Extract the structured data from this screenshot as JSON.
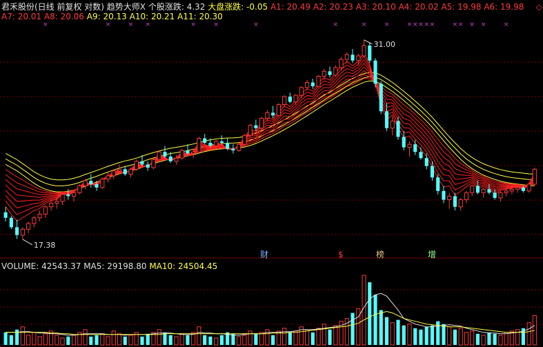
{
  "header": {
    "row1": [
      {
        "text": "君禾股份(日线 前复权 对数) 趋势大师X  个股涨跌: 4.32",
        "color": "#e0e0e0"
      },
      {
        "text": " 大盘涨跌: -0.05",
        "color": "#ffff44"
      },
      {
        "text": "  A1: 20.49  A2: 20.23  A3: 20.10  A4: 20.02  A5: 19.98  A6: 19.98",
        "color": "#ff3b3b"
      }
    ],
    "row2": [
      {
        "text": "A7: 20.01  A8: 20.06",
        "color": "#ff3b3b"
      },
      {
        "text": "  A9: 20.13  A10: 20.21  A11: 20.30",
        "color": "#ffff44"
      }
    ],
    "top_right_marker": "◇"
  },
  "volume_header": [
    {
      "text": "VOLUME: 42543.37",
      "color": "#e0e0e0"
    },
    {
      "text": "  MA5: 29198.80",
      "color": "#e0e0e0"
    },
    {
      "text": "  MA10: 24504.45",
      "color": "#ffff44"
    }
  ],
  "colors": {
    "background": "#000000",
    "grid": "#7a0000",
    "up_candle": "#ff3b3b",
    "down_candle": "#54ffff",
    "ribbon_red": "#ff2020",
    "ribbon_yellow": "#ffff44",
    "volume_up": "#ff3b3b",
    "volume_down": "#54ffff",
    "event_marker": "#cc44cc"
  },
  "chart_data": [
    {
      "type": "candlestick",
      "scale": "log",
      "ylim": [
        17.0,
        32.0
      ],
      "high_label": "31.00",
      "low_label": "17.38",
      "ohlc": [
        [
          18.8,
          19.1,
          18.3,
          18.5
        ],
        [
          18.5,
          18.6,
          17.9,
          18.0
        ],
        [
          18.0,
          18.4,
          17.4,
          17.6
        ],
        [
          17.6,
          18.0,
          17.38,
          17.9
        ],
        [
          17.9,
          18.3,
          17.7,
          18.2
        ],
        [
          18.2,
          18.6,
          18.0,
          18.5
        ],
        [
          18.5,
          18.9,
          18.3,
          18.7
        ],
        [
          18.7,
          19.2,
          18.5,
          19.1
        ],
        [
          19.1,
          19.5,
          18.9,
          19.3
        ],
        [
          19.3,
          19.6,
          19.0,
          19.4
        ],
        [
          19.4,
          19.9,
          19.2,
          19.8
        ],
        [
          19.8,
          20.1,
          19.5,
          19.7
        ],
        [
          19.7,
          20.0,
          19.4,
          19.9
        ],
        [
          19.9,
          20.4,
          19.8,
          20.3
        ],
        [
          20.3,
          20.7,
          20.1,
          20.6
        ],
        [
          20.6,
          21.0,
          20.2,
          20.4
        ],
        [
          20.4,
          20.6,
          20.0,
          20.2
        ],
        [
          20.2,
          20.8,
          20.1,
          20.7
        ],
        [
          20.7,
          21.1,
          20.5,
          20.9
        ],
        [
          20.9,
          21.3,
          20.7,
          21.2
        ],
        [
          21.2,
          21.6,
          21.0,
          21.3
        ],
        [
          21.3,
          21.5,
          20.9,
          21.0
        ],
        [
          21.0,
          21.4,
          20.8,
          21.3
        ],
        [
          21.3,
          21.9,
          21.2,
          21.8
        ],
        [
          21.8,
          22.2,
          21.5,
          21.6
        ],
        [
          21.6,
          21.8,
          21.2,
          21.4
        ],
        [
          21.4,
          22.0,
          21.3,
          21.9
        ],
        [
          21.9,
          22.5,
          21.8,
          22.4
        ],
        [
          22.4,
          22.8,
          22.0,
          22.1
        ],
        [
          22.1,
          22.4,
          21.7,
          21.8
        ],
        [
          21.8,
          22.2,
          21.6,
          22.0
        ],
        [
          22.0,
          22.6,
          21.9,
          22.5
        ],
        [
          22.5,
          22.9,
          22.2,
          22.3
        ],
        [
          22.3,
          22.6,
          22.0,
          22.4
        ],
        [
          22.4,
          23.4,
          22.3,
          23.3
        ],
        [
          23.3,
          23.6,
          22.9,
          23.0
        ],
        [
          23.0,
          23.3,
          22.7,
          22.8
        ],
        [
          22.8,
          23.2,
          22.6,
          23.1
        ],
        [
          23.1,
          23.5,
          22.9,
          23.0
        ],
        [
          23.0,
          23.3,
          22.5,
          22.6
        ],
        [
          22.6,
          22.9,
          22.3,
          22.5
        ],
        [
          22.5,
          23.0,
          22.4,
          22.9
        ],
        [
          22.9,
          23.6,
          22.8,
          23.5
        ],
        [
          23.5,
          24.3,
          23.4,
          24.2
        ],
        [
          24.2,
          24.6,
          23.8,
          24.0
        ],
        [
          24.0,
          24.8,
          23.9,
          24.7
        ],
        [
          24.7,
          25.3,
          24.5,
          25.1
        ],
        [
          25.1,
          25.6,
          24.7,
          24.9
        ],
        [
          24.9,
          25.8,
          24.8,
          25.7
        ],
        [
          25.7,
          26.4,
          25.5,
          26.3
        ],
        [
          26.3,
          26.6,
          25.8,
          25.9
        ],
        [
          25.9,
          26.5,
          25.7,
          26.4
        ],
        [
          26.4,
          27.1,
          26.2,
          27.0
        ],
        [
          27.0,
          27.6,
          26.8,
          27.4
        ],
        [
          27.4,
          27.7,
          26.9,
          27.1
        ],
        [
          27.1,
          28.0,
          27.0,
          27.9
        ],
        [
          27.9,
          28.5,
          27.6,
          28.3
        ],
        [
          28.3,
          28.7,
          27.8,
          28.0
        ],
        [
          28.0,
          28.8,
          27.9,
          28.6
        ],
        [
          28.6,
          29.5,
          28.4,
          29.3
        ],
        [
          29.3,
          29.9,
          29.0,
          29.7
        ],
        [
          29.7,
          30.2,
          29.0,
          29.2
        ],
        [
          29.2,
          29.8,
          28.8,
          29.6
        ],
        [
          29.6,
          31.0,
          29.5,
          30.5
        ],
        [
          30.5,
          30.8,
          29.0,
          29.2
        ],
        [
          29.2,
          29.4,
          27.0,
          27.3
        ],
        [
          27.3,
          27.5,
          25.0,
          25.2
        ],
        [
          25.2,
          25.8,
          23.8,
          24.0
        ],
        [
          24.0,
          24.8,
          23.5,
          24.5
        ],
        [
          24.5,
          24.8,
          23.2,
          23.4
        ],
        [
          23.4,
          23.8,
          22.5,
          22.7
        ],
        [
          22.7,
          23.1,
          22.1,
          22.9
        ],
        [
          22.9,
          23.2,
          22.2,
          22.4
        ],
        [
          22.4,
          22.7,
          21.9,
          22.0
        ],
        [
          22.0,
          22.3,
          21.3,
          21.5
        ],
        [
          21.5,
          21.8,
          20.6,
          20.8
        ],
        [
          20.8,
          21.0,
          19.8,
          20.0
        ],
        [
          20.0,
          20.3,
          19.3,
          19.5
        ],
        [
          19.5,
          19.9,
          19.0,
          19.7
        ],
        [
          19.7,
          19.9,
          18.9,
          19.1
        ],
        [
          19.1,
          19.6,
          18.9,
          19.5
        ],
        [
          19.5,
          20.0,
          19.3,
          19.9
        ],
        [
          19.9,
          20.4,
          19.7,
          20.3
        ],
        [
          20.3,
          20.6,
          19.8,
          19.9
        ],
        [
          19.9,
          20.2,
          19.6,
          20.1
        ],
        [
          20.1,
          20.4,
          19.8,
          19.9
        ],
        [
          19.9,
          20.1,
          19.5,
          19.6
        ],
        [
          19.6,
          20.0,
          19.4,
          19.9
        ],
        [
          19.9,
          20.2,
          19.7,
          20.0
        ],
        [
          20.0,
          20.3,
          19.8,
          20.1
        ],
        [
          20.1,
          20.4,
          19.9,
          20.2
        ],
        [
          20.2,
          20.3,
          19.9,
          20.0
        ],
        [
          20.0,
          20.5,
          19.9,
          20.4
        ],
        [
          20.4,
          21.4,
          20.3,
          21.3
        ]
      ],
      "ribbon_yellow": [
        [
          21.6,
          21.4,
          21.2,
          20.95,
          20.7,
          20.45,
          20.25,
          20.1,
          20.0,
          19.95,
          19.95,
          19.98,
          20.05,
          20.15,
          20.28,
          20.4,
          20.52,
          20.65,
          20.78,
          20.9,
          21.02,
          21.12,
          21.2,
          21.3,
          21.42,
          21.55,
          21.66,
          21.76,
          21.86,
          21.94,
          22.0,
          22.06,
          22.14,
          22.22,
          22.32,
          22.42,
          22.5,
          22.56,
          22.6,
          22.62,
          22.63,
          22.66,
          22.72,
          22.82,
          22.96,
          23.12,
          23.3,
          23.48,
          23.68,
          23.9,
          24.12,
          24.36,
          24.62,
          24.88,
          25.14,
          25.42,
          25.7,
          25.96,
          26.22,
          26.5,
          26.78,
          27.02,
          27.22,
          27.42,
          27.52,
          27.48,
          27.28,
          27.0,
          26.7,
          26.36,
          26.0,
          25.64,
          25.26,
          24.88,
          24.48,
          24.06,
          23.6,
          23.14,
          22.7,
          22.3,
          21.92,
          21.6,
          21.34,
          21.12,
          20.94,
          20.8,
          20.68,
          20.58,
          20.5,
          20.44,
          20.4,
          20.36,
          20.32,
          20.3
        ]
      ],
      "ribbon_red_spread": [
        0.1,
        0.2,
        0.3,
        0.4,
        0.5,
        0.6,
        0.7,
        0.8
      ],
      "event_labels": [
        "财",
        "$",
        "榜",
        "增"
      ]
    },
    {
      "type": "bar",
      "name": "VOLUME",
      "values": [
        18,
        14,
        22,
        26,
        14,
        18,
        12,
        16,
        20,
        14,
        10,
        12,
        14,
        18,
        22,
        12,
        14,
        16,
        12,
        20,
        16,
        12,
        14,
        18,
        12,
        16,
        18,
        22,
        18,
        14,
        12,
        16,
        14,
        18,
        26,
        14,
        12,
        10,
        14,
        18,
        16,
        12,
        14,
        20,
        16,
        18,
        22,
        14,
        20,
        24,
        18,
        20,
        26,
        22,
        18,
        24,
        30,
        22,
        28,
        34,
        38,
        46,
        52,
        100,
        90,
        72,
        50,
        40,
        32,
        36,
        28,
        30,
        24,
        22,
        26,
        28,
        34,
        30,
        26,
        22,
        24,
        18,
        20,
        16,
        14,
        18,
        16,
        14,
        18,
        20,
        22,
        24,
        32,
        42
      ],
      "up_flags": [
        0,
        0,
        0,
        1,
        1,
        1,
        1,
        1,
        1,
        1,
        1,
        0,
        1,
        1,
        1,
        0,
        0,
        1,
        1,
        1,
        1,
        0,
        1,
        1,
        0,
        0,
        1,
        1,
        0,
        0,
        1,
        1,
        0,
        1,
        1,
        0,
        0,
        1,
        0,
        0,
        0,
        1,
        1,
        1,
        0,
        1,
        1,
        0,
        1,
        1,
        0,
        1,
        1,
        1,
        0,
        1,
        1,
        0,
        1,
        1,
        1,
        0,
        1,
        1,
        0,
        0,
        0,
        0,
        1,
        0,
        0,
        1,
        0,
        0,
        0,
        0,
        0,
        0,
        1,
        0,
        1,
        1,
        1,
        0,
        1,
        0,
        0,
        1,
        1,
        1,
        1,
        0,
        1,
        1
      ],
      "ma5": [
        18,
        18,
        18,
        19,
        19,
        18,
        17,
        17,
        16,
        16,
        15,
        14,
        14,
        15,
        16,
        16,
        16,
        16,
        15,
        15,
        15,
        14,
        15,
        15,
        15,
        15,
        16,
        17,
        17,
        17,
        16,
        15,
        15,
        15,
        18,
        17,
        17,
        16,
        16,
        15,
        14,
        14,
        15,
        16,
        16,
        16,
        18,
        18,
        18,
        19,
        19,
        20,
        22,
        22,
        22,
        23,
        24,
        25,
        26,
        28,
        31,
        36,
        40,
        54,
        66,
        72,
        74,
        70,
        60,
        50,
        38,
        34,
        30,
        28,
        26,
        26,
        27,
        28,
        29,
        28,
        27,
        24,
        22,
        20,
        18,
        17,
        17,
        16,
        16,
        17,
        18,
        20,
        23,
        28
      ],
      "ma10": [
        18,
        18,
        18,
        18,
        18,
        18,
        18,
        18,
        17,
        17,
        16,
        16,
        15,
        15,
        15,
        15,
        15,
        15,
        15,
        15,
        15,
        15,
        15,
        15,
        15,
        15,
        15,
        15,
        16,
        16,
        16,
        16,
        16,
        16,
        16,
        16,
        16,
        16,
        16,
        16,
        16,
        16,
        16,
        16,
        16,
        16,
        16,
        17,
        17,
        17,
        18,
        18,
        19,
        20,
        21,
        22,
        23,
        24,
        25,
        26,
        27,
        29,
        31,
        36,
        40,
        44,
        46,
        48,
        46,
        42,
        38,
        36,
        34,
        32,
        30,
        29,
        28,
        27,
        26,
        26,
        26,
        25,
        24,
        23,
        22,
        21,
        20,
        19,
        18,
        18,
        18,
        18,
        19,
        21
      ]
    }
  ]
}
